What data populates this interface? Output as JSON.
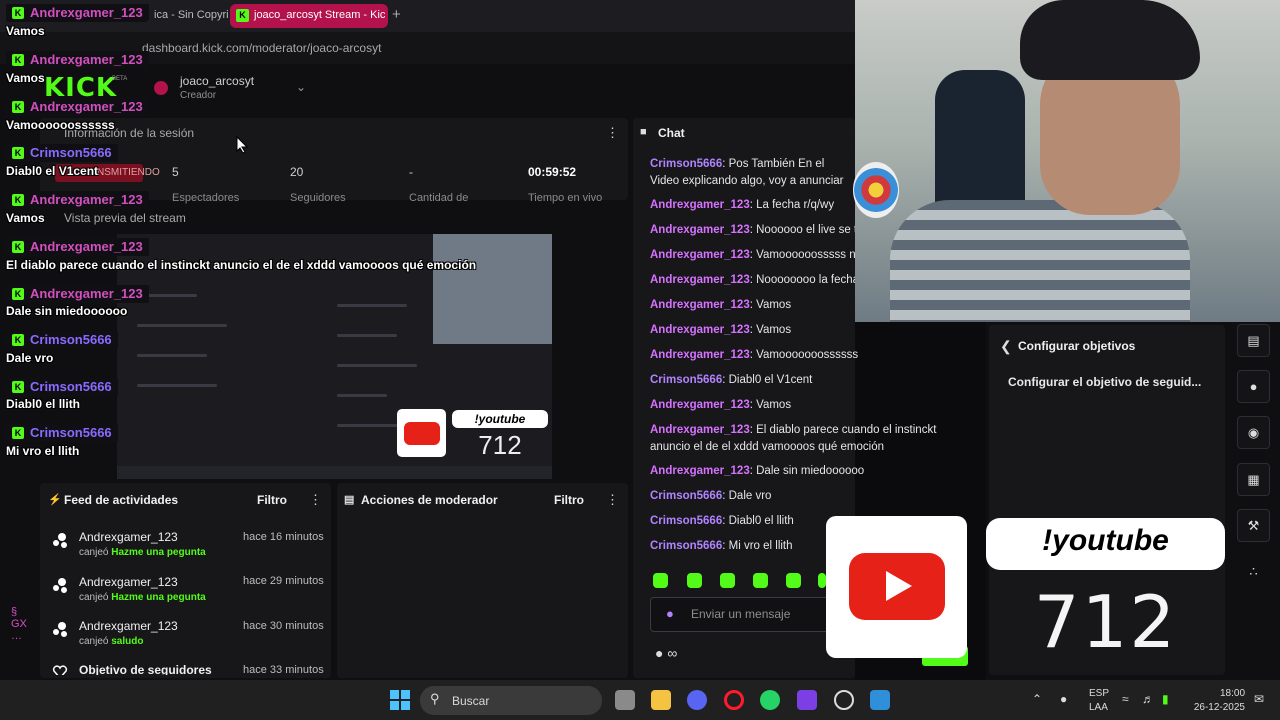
{
  "browser": {
    "tabs": [
      {
        "label": "ica - Sin Copyric"
      },
      {
        "label": "joaco_arcosyt Stream - Kic"
      }
    ],
    "new_tab": "+",
    "url": "dashboard.kick.com/moderator/joaco-arcosyt"
  },
  "dashboard": {
    "logo": "KICK",
    "beta": "BETA",
    "creator_name": "joaco_arcosyt",
    "creator_role": "Creador",
    "session_title": "Información de la sesión",
    "live_badge": "TRANSMITIENDO",
    "stats": [
      {
        "value": "5",
        "label": "Espectadores"
      },
      {
        "value": "20",
        "label": "Seguidores"
      },
      {
        "value": "-",
        "label": "Cantidad de"
      },
      {
        "value": "00:59:52",
        "label": "Tiempo en vivo"
      }
    ],
    "preview_title": "Vista previa del stream",
    "preview_overlay_label": "!youtube",
    "preview_overlay_number": "712"
  },
  "feed": {
    "title": "Feed de actividades",
    "filter": "Filtro",
    "items": [
      {
        "user": "Andrexgamer_123",
        "action": "canjeó",
        "reward": "Hazme una pegunta",
        "time": "hace 16 minutos"
      },
      {
        "user": "Andrexgamer_123",
        "action": "canjeó",
        "reward": "Hazme una pegunta",
        "time": "hace 29 minutos"
      },
      {
        "user": "Andrexgamer_123",
        "action": "canjeó",
        "reward": "saludo",
        "time": "hace 30 minutos"
      },
      {
        "user": "Objetivo de seguidores",
        "action": "",
        "reward": "",
        "time": "hace 33 minutos"
      }
    ]
  },
  "moderator": {
    "title": "Acciones de moderador",
    "filter": "Filtro"
  },
  "chat": {
    "title": "Chat",
    "messages": [
      {
        "user": "Crimson5666",
        "text": ": Pos También En el Video explicando algo, voy a anunciar algo Ep"
      },
      {
        "user": "Andrexgamer_123",
        "text": ": La fecha r/q/wy"
      },
      {
        "user": "Andrexgamer_123",
        "text": ": Noooooo el live se t"
      },
      {
        "user": "Andrexgamer_123",
        "text": ": Vamoooooosssss n"
      },
      {
        "user": "Andrexgamer_123",
        "text": ": Noooooooo la fecha"
      },
      {
        "user": "Andrexgamer_123",
        "text": ": Vamos"
      },
      {
        "user": "Andrexgamer_123",
        "text": ": Vamos"
      },
      {
        "user": "Andrexgamer_123",
        "text": ": Vamooooooossssss"
      },
      {
        "user": "Crimson5666",
        "text": ": Diabl0 el V1cent"
      },
      {
        "user": "Andrexgamer_123",
        "text": ": Vamos"
      },
      {
        "user": "Andrexgamer_123",
        "text": ": El diablo parece cuando el instinckt anuncio el de el xddd vamoooos qué emoción"
      },
      {
        "user": "Andrexgamer_123",
        "text": ": Dale sin miedoooooo"
      },
      {
        "user": "Crimson5666",
        "text": ": Dale vro"
      },
      {
        "user": "Crimson5666",
        "text": ": Diabl0 el llith"
      },
      {
        "user": "Crimson5666",
        "text": ": Mi vro el llith"
      }
    ],
    "input_placeholder": "Enviar un mensaje"
  },
  "overlay_chat": [
    {
      "user": "Andrexgamer_123",
      "text": "Vamos"
    },
    {
      "user": "Andrexgamer_123",
      "text": "Vamos"
    },
    {
      "user": "Andrexgamer_123",
      "text": "Vamoooooossssss"
    },
    {
      "user": "Crimson5666",
      "text": "Diabl0 el V1cent"
    },
    {
      "user": "Andrexgamer_123",
      "text": "Vamos"
    },
    {
      "user": "Andrexgamer_123",
      "text": "El diablo parece cuando el instinckt anuncio el de el xddd vamoooos qué emoción"
    },
    {
      "user": "Andrexgamer_123",
      "text": "Dale sin miedoooooo"
    },
    {
      "user": "Crimson5666",
      "text": "Dale vro"
    },
    {
      "user": "Crimson5666",
      "text": "Diabl0 el llith"
    },
    {
      "user": "Crimson5666",
      "text": "Mi vro el llith"
    }
  ],
  "goals": {
    "title": "Configurar objetivos",
    "item": "Configurar el objetivo de seguid..."
  },
  "youtube_overlay": {
    "label": "!youtube",
    "number": "712"
  },
  "taskbar": {
    "search_label": "Buscar",
    "lang_line1": "ESP",
    "lang_line2": "LAA",
    "time": "18:00",
    "date": "26-12-2025"
  },
  "colors": {
    "kick_green": "#53fc18",
    "user_andrex": "#d672ff",
    "user_crimson": "#b183ff",
    "youtube_red": "#e62117"
  }
}
